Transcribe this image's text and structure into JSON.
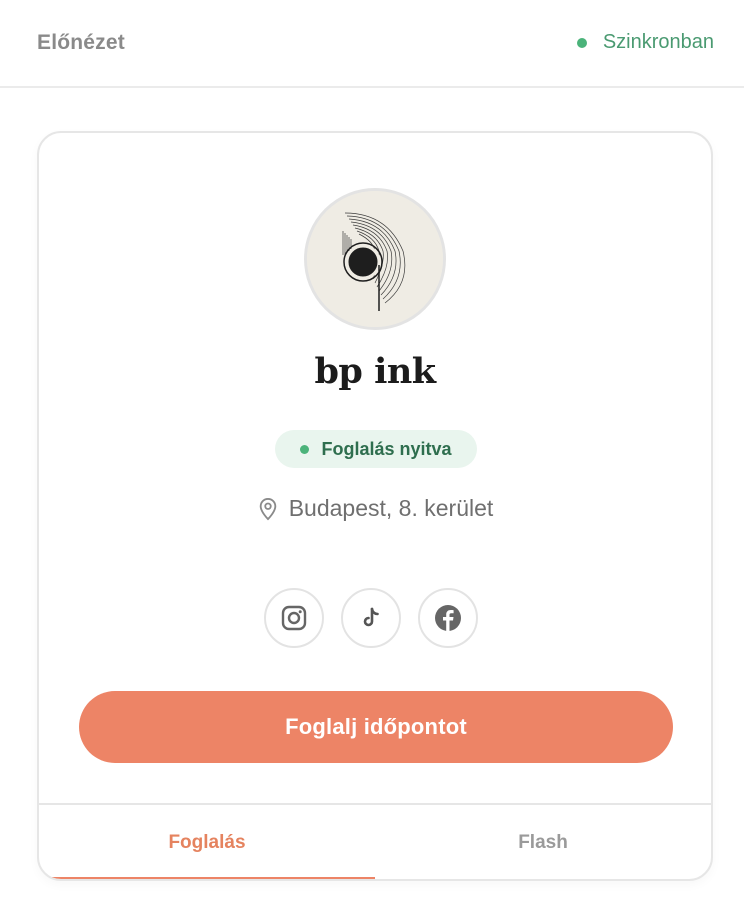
{
  "header": {
    "title": "Előnézet",
    "sync_status": "Szinkronban"
  },
  "profile": {
    "name": "bp ink",
    "status": "Foglalás nyitva",
    "location": "Budapest, 8. kerület",
    "socials": [
      {
        "icon": "instagram-icon"
      },
      {
        "icon": "tiktok-icon"
      },
      {
        "icon": "facebook-icon"
      }
    ],
    "cta_label": "Foglalj időpontot"
  },
  "tabs": [
    {
      "label": "Foglalás",
      "active": true
    },
    {
      "label": "Flash",
      "active": false
    }
  ],
  "colors": {
    "accent": "#ed8466",
    "status_green": "#4bb37a",
    "status_bg": "#e9f5ee"
  }
}
